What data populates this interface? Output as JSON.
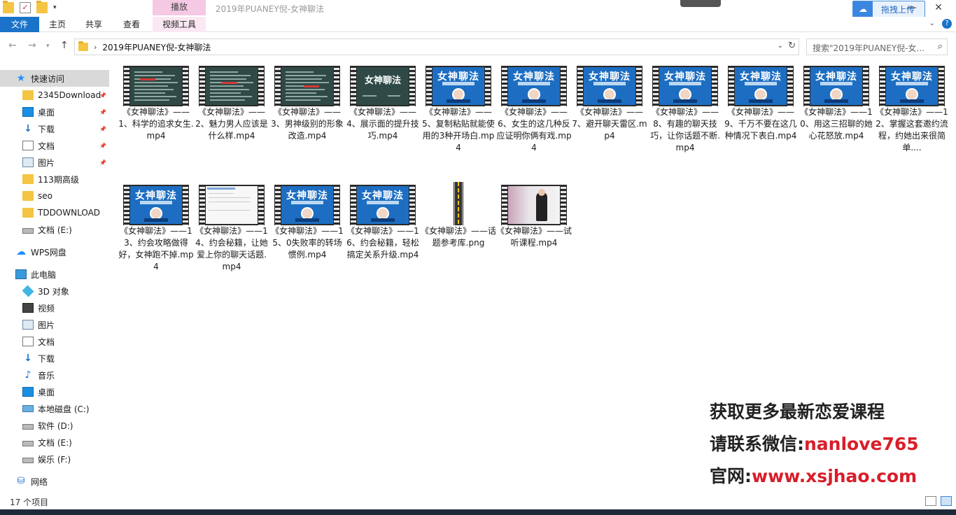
{
  "window": {
    "title": "2019年PUANEY倪-女神聊法",
    "context_tab_header": "播放",
    "upload_label": "拖拽上传",
    "minimize": "—",
    "close": "✕"
  },
  "ribbon": {
    "tabs": [
      "文件",
      "主页",
      "共享",
      "查看",
      "视频工具"
    ]
  },
  "address": {
    "path": "2019年PUANEY倪-女神聊法",
    "search_placeholder": "搜索\"2019年PUANEY倪-女..."
  },
  "sidebar": {
    "items": [
      {
        "label": "快速访问",
        "icon": "star-icon",
        "pinned": false,
        "selected": true
      },
      {
        "label": "2345Download",
        "icon": "folder-icon",
        "pinned": true
      },
      {
        "label": "桌面",
        "icon": "desktop-icon",
        "pinned": true
      },
      {
        "label": "下载",
        "icon": "download-icon",
        "pinned": true
      },
      {
        "label": "文档",
        "icon": "document-icon",
        "pinned": true
      },
      {
        "label": "图片",
        "icon": "picture-icon",
        "pinned": true
      },
      {
        "label": "113期高级",
        "icon": "folder-icon",
        "pinned": false
      },
      {
        "label": "seo",
        "icon": "folder-icon",
        "pinned": false
      },
      {
        "label": "TDDOWNLOAD",
        "icon": "folder-icon",
        "pinned": false
      },
      {
        "label": "文档 (E:)",
        "icon": "drive-icon",
        "pinned": false
      },
      {
        "label": "WPS网盘",
        "icon": "cloud-icon",
        "pinned": false
      },
      {
        "label": "此电脑",
        "icon": "computer-icon",
        "pinned": false
      },
      {
        "label": "3D 对象",
        "icon": "cube-icon",
        "pinned": false
      },
      {
        "label": "视频",
        "icon": "video-icon",
        "pinned": false
      },
      {
        "label": "图片",
        "icon": "picture-icon",
        "pinned": false
      },
      {
        "label": "文档",
        "icon": "document-icon",
        "pinned": false
      },
      {
        "label": "下载",
        "icon": "download-icon",
        "pinned": false
      },
      {
        "label": "音乐",
        "icon": "music-icon",
        "pinned": false
      },
      {
        "label": "桌面",
        "icon": "desktop-icon",
        "pinned": false
      },
      {
        "label": "本地磁盘 (C:)",
        "icon": "system-drive-icon",
        "pinned": false
      },
      {
        "label": "软件 (D:)",
        "icon": "drive-icon",
        "pinned": false
      },
      {
        "label": "文档 (E:)",
        "icon": "drive-icon",
        "pinned": false
      },
      {
        "label": "娱乐 (F:)",
        "icon": "drive-icon",
        "pinned": false
      },
      {
        "label": "网络",
        "icon": "network-icon",
        "pinned": false
      }
    ]
  },
  "files": [
    {
      "name": "《女神聊法》——1、科学的追求女生.mp4",
      "thumb": "dark"
    },
    {
      "name": "《女神聊法》——2、魅力男人应该是什么样.mp4",
      "thumb": "dark"
    },
    {
      "name": "《女神聊法》——3、男神级别的形象改造.mp4",
      "thumb": "dark"
    },
    {
      "name": "《女神聊法》——4、展示面的提升技巧.mp4",
      "thumb": "darktitle"
    },
    {
      "name": "《女神聊法》——5、复制粘贴就能使用的3种开场白.mp4",
      "thumb": "blue"
    },
    {
      "name": "《女神聊法》——6、女生的这几种反应证明你俩有戏.mp4",
      "thumb": "blue"
    },
    {
      "name": "《女神聊法》——7、避开聊天雷区.mp4",
      "thumb": "blue"
    },
    {
      "name": "《女神聊法》——8、有趣的聊天技巧，让你话题不断.mp4",
      "thumb": "blue"
    },
    {
      "name": "《女神聊法》——9、千万不要在这几种情况下表白.mp4",
      "thumb": "blue"
    },
    {
      "name": "《女神聊法》——10、用这三招聊的她心花怒放.mp4",
      "thumb": "blue"
    },
    {
      "name": "《女神聊法》——12、掌握这套邀约流程，约她出来很简单....",
      "thumb": "blue"
    },
    {
      "name": "《女神聊法》——13、约会攻略做得好，女神跑不掉.mp4",
      "thumb": "blue"
    },
    {
      "name": "《女神聊法》——14、约会秘籍，让她爱上你的聊天话题.mp4",
      "thumb": "white"
    },
    {
      "name": "《女神聊法》——15、0失败率的转场惯例.mp4",
      "thumb": "blue"
    },
    {
      "name": "《女神聊法》——16、约会秘籍，轻松搞定关系升级.mp4",
      "thumb": "blue"
    },
    {
      "name": "《女神聊法》——话题参考库.png",
      "thumb": "road"
    },
    {
      "name": "《女神聊法》——试听课程.mp4",
      "thumb": "photo"
    }
  ],
  "thumb_title": "女神聊法",
  "promo": {
    "line1": "获取更多最新恋爱课程",
    "line2_prefix": "请联系微信:",
    "line2_value": "nanlove765",
    "line3_prefix": "官网:",
    "line3_value": "www.xsjhao.com"
  },
  "status": {
    "count": "17 个项目"
  },
  "colors": {
    "accent": "#1a73c8",
    "context_tab": "#f5c9e3",
    "promo_red": "#d81e2a"
  }
}
